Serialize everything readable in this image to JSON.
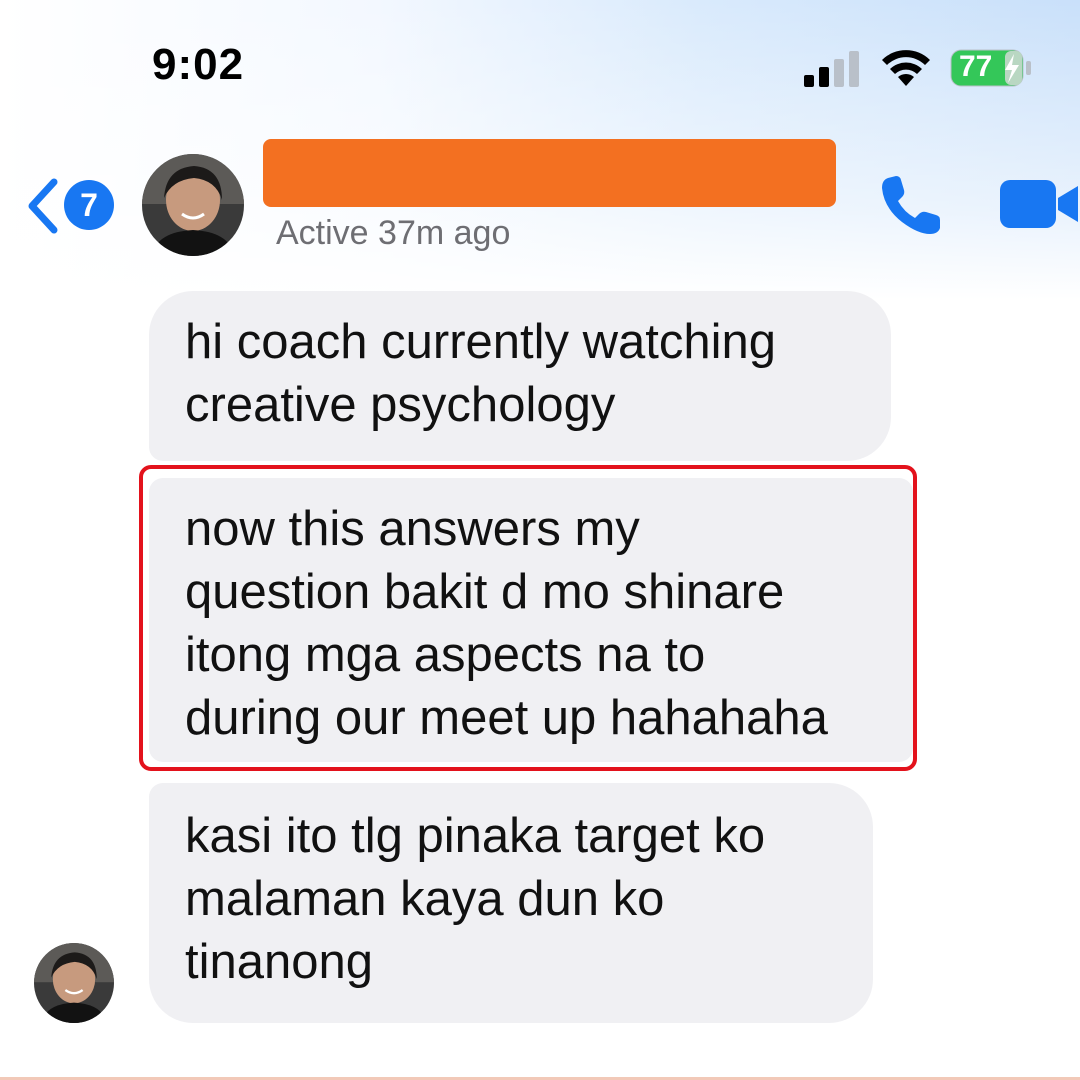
{
  "status_bar": {
    "time": "9:02",
    "battery_level": "77"
  },
  "header": {
    "back_badge_count": "7",
    "contact_name_redacted_color": "#f37021",
    "active_status": "Active 37m ago",
    "icons": [
      "back-chevron-icon",
      "phone-icon",
      "video-camera-icon"
    ]
  },
  "messages": [
    {
      "lines": [
        "hi coach currently watching",
        "creative psychology"
      ]
    },
    {
      "lines": [
        "now this answers my",
        "question bakit d mo shinare",
        "itong mga aspects na to",
        "during our meet up hahahaha"
      ],
      "highlighted": true
    },
    {
      "lines": [
        "kasi ito tlg pinaka target ko",
        "malaman kaya dun ko",
        "tinanong"
      ]
    }
  ],
  "colors": {
    "accent": "#1877f2",
    "bubble": "#f0f0f3",
    "highlight": "#e3121c",
    "battery": "#34c759"
  }
}
